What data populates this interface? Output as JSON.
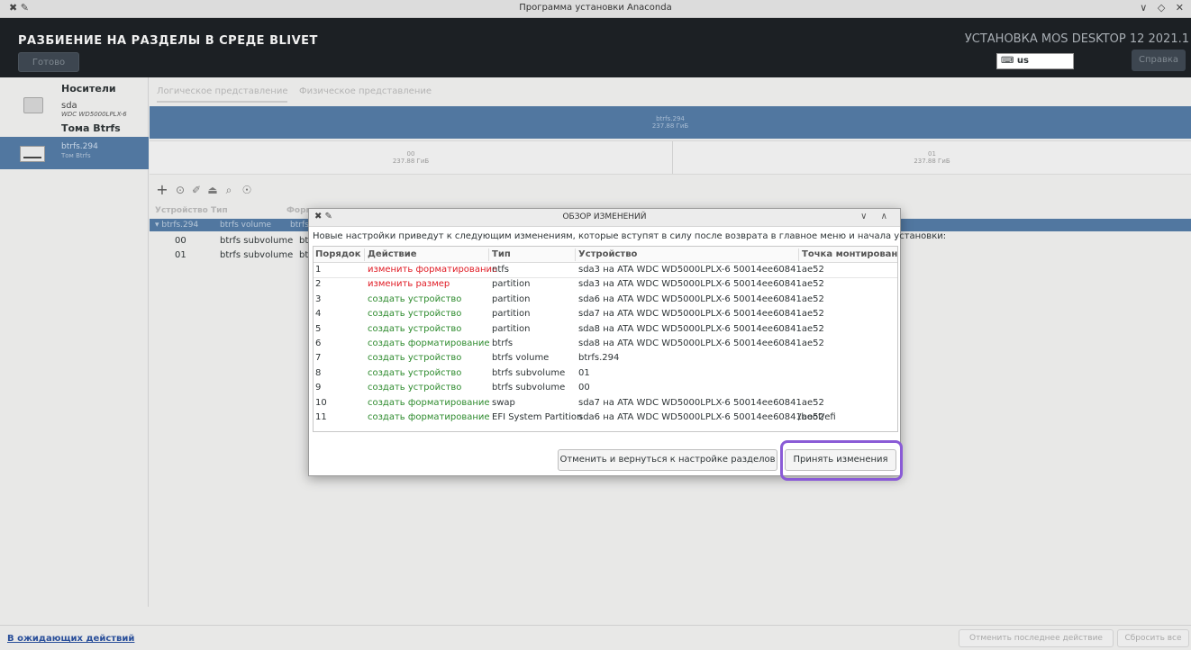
{
  "window": {
    "title": "Программа установки Anaconda"
  },
  "header": {
    "spoke_title": "РАЗБИЕНИЕ НА РАЗДЕЛЫ В СРЕДЕ BLIVET",
    "done_label": "Готово",
    "product": "УСТАНОВКА MOS DESKTOP 12 2021.1",
    "keyboard": "us",
    "help_label": "Справка"
  },
  "sidebar": {
    "group_media": "Носители",
    "disk_name": "sda",
    "disk_model": "WDC WD5000LPLX-6",
    "group_btrfs": "Тома Btrfs",
    "volume_name": "btrfs.294",
    "volume_type": "Том Btrfs"
  },
  "main": {
    "tab_logical": "Логическое представление",
    "tab_physical": "Физическое представление",
    "bar_top_name": "btrfs.294",
    "bar_top_size": "237.88 ГиБ",
    "seg1_name": "00",
    "seg1_size": "237.88 ГиБ",
    "seg2_name": "01",
    "seg2_size": "237.88 ГиБ",
    "columns": [
      "Устройство",
      "Тип",
      "Формат"
    ],
    "volume_row": {
      "device": "▾ btrfs.294",
      "type": "btrfs volume",
      "format": "btrfs"
    },
    "subvol_rows": [
      {
        "device": "00",
        "type": "btrfs subvolume",
        "format": "btrfs"
      },
      {
        "device": "01",
        "type": "btrfs subvolume",
        "format": "btrfs"
      }
    ]
  },
  "dialog": {
    "title": "ОБЗОР ИЗМЕНЕНИЙ",
    "message": "Новые настройки приведут к следующим изменениям, которые вступят в силу после возврата в главное меню и начала установки:",
    "headers": {
      "order": "Порядок",
      "action": "Действие",
      "type": "Тип",
      "device": "Устройство",
      "mount": "Точка монтирования"
    },
    "rows": [
      {
        "order": "1",
        "action": "изменить форматирование",
        "kind": "destroy",
        "type": "ntfs",
        "device": "sda3 на ATA WDC WD5000LPLX-6 50014ee60841ae52",
        "mount": ""
      },
      {
        "order": "2",
        "action": "изменить размер",
        "kind": "destroy",
        "type": "partition",
        "device": "sda3 на ATA WDC WD5000LPLX-6 50014ee60841ae52",
        "mount": ""
      },
      {
        "order": "3",
        "action": "создать устройство",
        "kind": "create",
        "type": "partition",
        "device": "sda6 на ATA WDC WD5000LPLX-6 50014ee60841ae52",
        "mount": ""
      },
      {
        "order": "4",
        "action": "создать устройство",
        "kind": "create",
        "type": "partition",
        "device": "sda7 на ATA WDC WD5000LPLX-6 50014ee60841ae52",
        "mount": ""
      },
      {
        "order": "5",
        "action": "создать устройство",
        "kind": "create",
        "type": "partition",
        "device": "sda8 на ATA WDC WD5000LPLX-6 50014ee60841ae52",
        "mount": ""
      },
      {
        "order": "6",
        "action": "создать форматирование",
        "kind": "create",
        "type": "btrfs",
        "device": "sda8 на ATA WDC WD5000LPLX-6 50014ee60841ae52",
        "mount": ""
      },
      {
        "order": "7",
        "action": "создать устройство",
        "kind": "create",
        "type": "btrfs volume",
        "device": "btrfs.294",
        "mount": ""
      },
      {
        "order": "8",
        "action": "создать устройство",
        "kind": "create",
        "type": "btrfs subvolume",
        "device": "01",
        "mount": ""
      },
      {
        "order": "9",
        "action": "создать устройство",
        "kind": "create",
        "type": "btrfs subvolume",
        "device": "00",
        "mount": ""
      },
      {
        "order": "10",
        "action": "создать форматирование",
        "kind": "create",
        "type": "swap",
        "device": "sda7 на ATA WDC WD5000LPLX-6 50014ee60841ae52",
        "mount": ""
      },
      {
        "order": "11",
        "action": "создать форматирование",
        "kind": "create",
        "type": "EFI System Partition",
        "device": "sda6 на ATA WDC WD5000LPLX-6 50014ee60841ae52",
        "mount": "/boot/efi"
      }
    ],
    "cancel_label": "Отменить и вернуться к настройке разделов",
    "accept_label": "Принять изменения"
  },
  "footer": {
    "pending_label": "В ожидающих действий",
    "undo_label": "Отменить последнее действие",
    "reset_label": "Сбросить все"
  },
  "colors": {
    "destroy": "#e01b24",
    "create": "#2e8b2e",
    "selection": "#5177a0",
    "highlight": "#8a5bd6"
  }
}
